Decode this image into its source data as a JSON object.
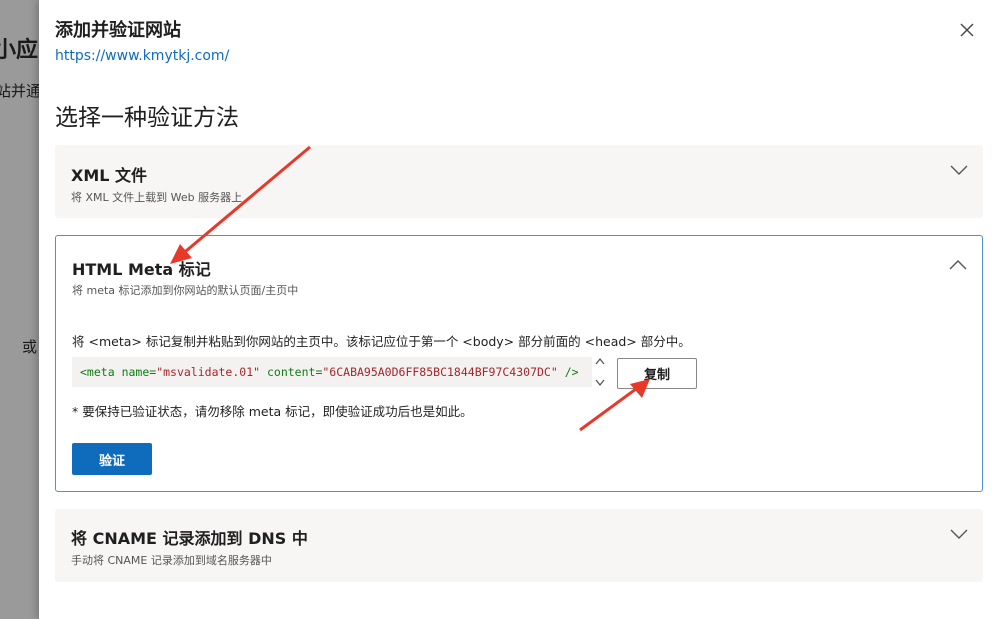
{
  "background": {
    "title_fragment": "小应网",
    "subtitle_fragment": "站并通",
    "or_fragment": "或"
  },
  "panel": {
    "title": "添加并验证网站",
    "url": "https://www.kmytkj.com/",
    "close_icon": "close-icon"
  },
  "section_heading": "选择一种验证方法",
  "methods": {
    "xml": {
      "title": "XML 文件",
      "description": "将 XML 文件上载到 Web 服务器上",
      "chevron_icon": "chevron-down-icon"
    },
    "html_meta": {
      "title": "HTML Meta 标记",
      "description": "将 meta 标记添加到你网站的默认页面/主页中",
      "chevron_icon": "chevron-up-icon",
      "instruction": "将 <meta> 标记复制并粘贴到你网站的主页中。该标记应位于第一个 <body> 部分前面的 <head> 部分中。",
      "meta_tag": {
        "open": "<meta",
        "name_attr": "name=",
        "name_value": "\"msvalidate.01\"",
        "content_attr": "content=",
        "content_value": "\"6CABA95A0D6FF85BC1844BF97C4307DC\"",
        "close": "/>"
      },
      "copy_label": "复制",
      "note": "* 要保持已验证状态，请勿移除 meta 标记，即使验证成功后也是如此。",
      "verify_label": "验证"
    },
    "cname": {
      "title": "将 CNAME 记录添加到 DNS 中",
      "description": "手动将 CNAME 记录添加到域名服务器中",
      "chevron_icon": "chevron-down-icon"
    }
  },
  "colors": {
    "accent": "#0f6cbd",
    "annotation_arrow": "#e8382a",
    "card_border_active": "#4f8fd6"
  }
}
